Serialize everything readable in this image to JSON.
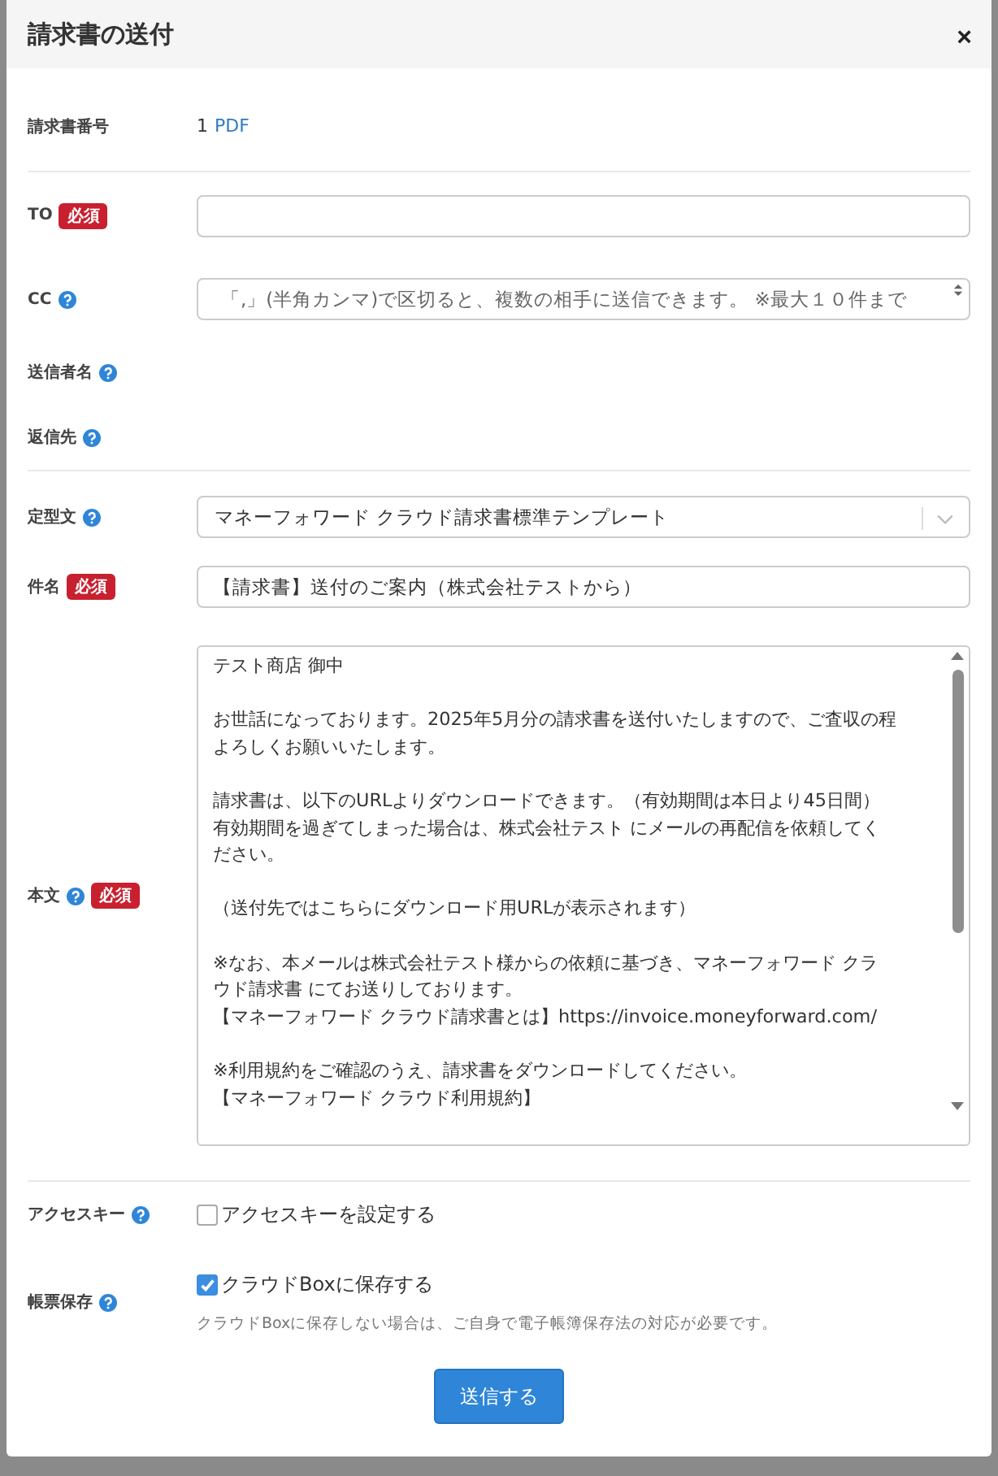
{
  "dialog": {
    "title": "請求書の送付",
    "close": "×"
  },
  "invoice_number": {
    "label": "請求書番号",
    "number": "1",
    "link": "PDF"
  },
  "fields": [
    {
      "kind": "input",
      "label": "TO",
      "required": true,
      "help": false,
      "badge": "必須"
    },
    {
      "kind": "textarea",
      "label": "CC",
      "required": false,
      "help": true,
      "placeholder": "「,」(半角カンマ)で区切ると、複数の相手に送信できます。 ※最大１０件まで"
    },
    {
      "kind": "plain",
      "label": "送信者名",
      "required": false,
      "help": true
    },
    {
      "kind": "plain",
      "label": "返信先",
      "required": false,
      "help": true
    }
  ],
  "template": {
    "label": "定型文",
    "help": true,
    "value": "マネーフォワード クラウド請求書標準テンプレート"
  },
  "subject": {
    "label": "件名",
    "badge": "必須",
    "value": "【請求書】送付のご案内（株式会社テストから）"
  },
  "body": {
    "label": "本文",
    "badge": "必須",
    "paragraphs": [
      [
        "テスト商店 御中"
      ],
      [
        "お世話になっております。2025年5月分の請求書を送付いたしますので、ご査収の程",
        "よろしくお願いいたします。"
      ],
      [
        "請求書は、以下のURLよりダウンロードできます。（有効期間は本日より45日間）",
        "有効期間を過ぎてしまった場合は、株式会社テスト にメールの再配信を依頼してく",
        "ださい。"
      ],
      [
        "（送付先ではこちらにダウンロード用URLが表示されます）"
      ],
      [
        "※なお、本メールは株式会社テスト様からの依頼に基づき、マネーフォワード クラ",
        "ウド請求書 にてお送りしております。",
        "【マネーフォワード クラウド請求書とは】https://invoice.moneyforward.com/"
      ],
      [
        "※利用規約をご確認のうえ、請求書をダウンロードしてください。",
        "【マネーフォワード クラウド利用規約】"
      ]
    ]
  },
  "access_key": {
    "label": "アクセスキー",
    "option": "アクセスキーを設定する",
    "checked": false
  },
  "storage": {
    "label": "帳票保存",
    "option": "クラウドBoxに保存する",
    "checked": true,
    "note": "クラウドBoxに保存しない場合は、ご自身で電子帳簿保存法の対応が必要です。"
  },
  "submit": "送信する"
}
